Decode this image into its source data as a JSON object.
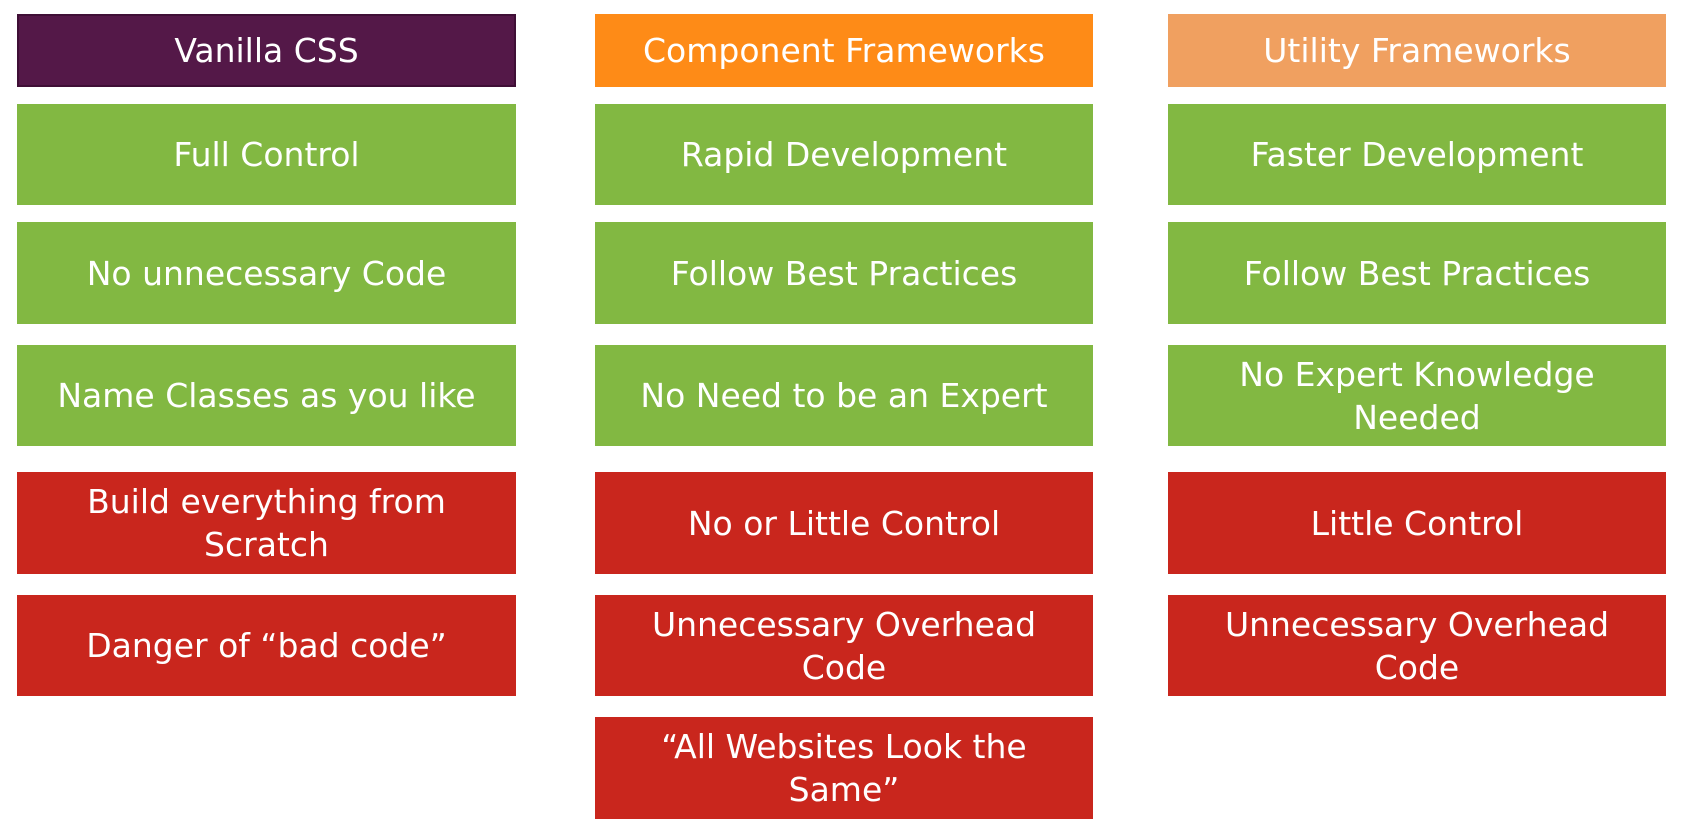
{
  "columns": [
    {
      "header": "Vanilla CSS",
      "header_color": "#541848",
      "pros": [
        "Full Control",
        "No unnecessary Code",
        "Name Classes as you like"
      ],
      "cons": [
        "Build everything from Scratch",
        "Danger of “bad code”"
      ]
    },
    {
      "header": "Component Frameworks",
      "header_color": "#fe8b17",
      "pros": [
        "Rapid Development",
        "Follow Best Practices",
        "No Need to be an Expert"
      ],
      "cons": [
        "No or Little Control",
        "Unnecessary Overhead Code",
        "“All Websites Look the Same”"
      ]
    },
    {
      "header": "Utility Frameworks",
      "header_color": "#f0a060",
      "pros": [
        "Faster Development",
        "Follow Best Practices",
        "No Expert Knowledge Needed"
      ],
      "cons": [
        "Little Control",
        "Unnecessary Overhead Code"
      ]
    }
  ],
  "colors": {
    "pro": "#82b842",
    "con": "#c9261d"
  }
}
